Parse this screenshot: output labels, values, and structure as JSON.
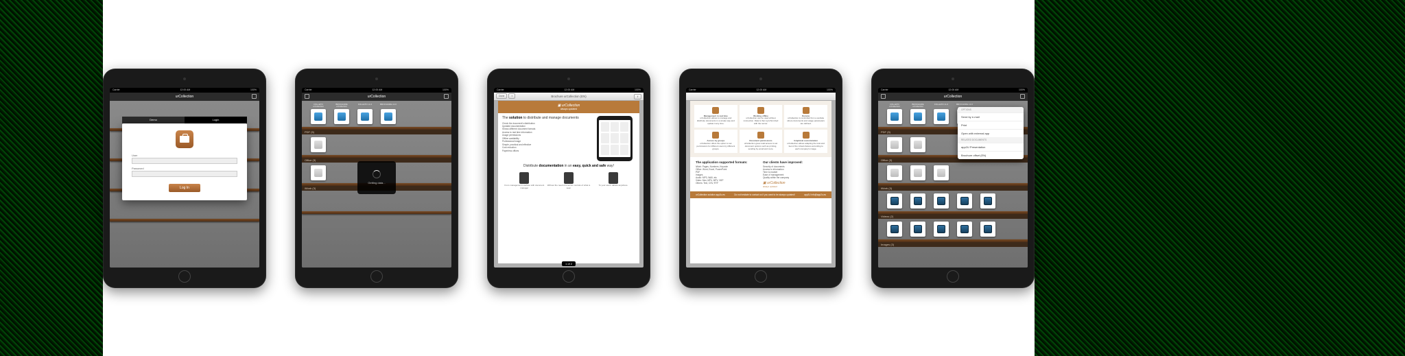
{
  "status": {
    "carrier": "Carrier",
    "time": "12:00 AM",
    "battery": "100%"
  },
  "app_title": "urCollection",
  "s1": {
    "tabs": {
      "demo": "Demo",
      "login": "Login"
    },
    "user_label": "User",
    "password_label": "Password",
    "login_button": "Log In"
  },
  "s2": {
    "shelves": {
      "pdf": "PDF (5)",
      "office": "Office (3)",
      "iwork": "iWork (3)"
    },
    "docs_top": [
      {
        "label": "FOLLETO urCollection"
      },
      {
        "label": "BROCHURE urCollection"
      },
      {
        "label": "FOLLETO v1.0"
      },
      {
        "label": "BROCHURE v1.0"
      }
    ],
    "overlay": "Getting data..."
  },
  "s3": {
    "nav_title": "Brochure urCollection (EN)",
    "done": "Done",
    "brand": "urCollection",
    "tagline": "always updated",
    "h1_pre": "The ",
    "h1_bold": "solution",
    "h1_post": " to distribute and manage documents",
    "bullets": [
      "Check the document's distribution",
      "Updated documentation",
      "Shows different document formats",
      "Access to real time information",
      "Usage permissions",
      "Offline availability",
      "Professional image",
      "Simple, practical and effective",
      "Cost reduction",
      "Paperless offices"
    ],
    "h2_pre": "Distribute ",
    "h2_bold": "documentation",
    "h2_mid": " in an ",
    "h2_bold2": "easy, quick and safe",
    "h2_post": " way!",
    "device_caps": [
      "From management interface with document manager",
      "Without the need of a server controls of what is seen",
      "To your users' tablets anywhere"
    ],
    "page_indicator": "1 of 2"
  },
  "s4": {
    "cells": [
      {
        "title": "Management in real time",
        "body": "urCollection allows to manage and distribute documents in a simple way and update it any time."
      },
      {
        "title": "Working offline",
        "body": "urCollection can be used without connection. Data is then synchronized with the server."
      },
      {
        "title": "Remote",
        "body": "urCollection is controlled from a website where documents and usage parameters are defined."
      },
      {
        "title": "Access by groups",
        "body": "urCollection offers the option to set permissions for different users by different groups."
      },
      {
        "title": "Document permissions",
        "body": "urCollection gives total access to set document options such as printing, sending by email and more."
      },
      {
        "title": "Graphical customization",
        "body": "urCollection allows adapting the look and feel of the virtual shelves according to each company's image."
      }
    ],
    "formats_h": "The application supported formats:",
    "formats": [
      "iWork: Pages, Numbers, Keynote",
      "Office: Word, Excel, PowerPoint",
      "PDF",
      "Images",
      "Audio: MP3, WAV, etc",
      "Video: Mov, MP4, MPV, 3GP",
      "Others: Text, CSV, RTF"
    ],
    "clients_h": "Our clients have improved:",
    "clients": [
      "Security of documents",
      "Access to information",
      "Time to market",
      "Ease of management",
      "Quality within the company"
    ],
    "brand": "urCollection",
    "brand_sub": "always updated",
    "foot_left": "urCollection solution app2u.es",
    "foot_mid": "Do not hesitate to contact us if you want to be always updated!",
    "foot_right": "app2U  info@app2u.es"
  },
  "s5": {
    "shelves": {
      "pdf": "PDF (5)",
      "office": "Office (3)",
      "iwork": "iWork (3)",
      "videos": "Videos (2)",
      "images": "Images (3)"
    },
    "popover": {
      "sec1": "OPTIONS",
      "email": "Send by e-mail",
      "print": "Print",
      "open": "Open with external app",
      "sec2": "RELATED DOCUMENTS",
      "rel1": "app2U Presentation",
      "rel2": "Brochure offset (EN)"
    }
  }
}
